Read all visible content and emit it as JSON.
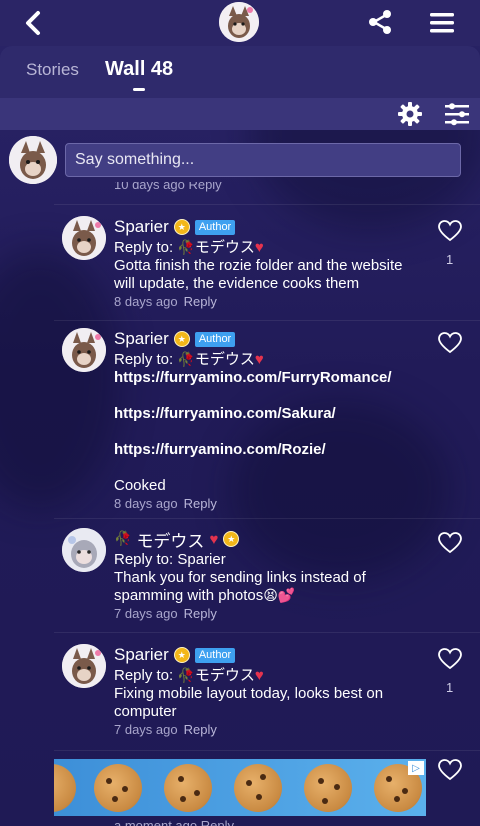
{
  "header": {
    "back_icon": "chevron-left-icon",
    "share_icon": "share-icon",
    "menu_icon": "hamburger-menu-icon"
  },
  "tabs": [
    {
      "label": "Stories",
      "active": false
    },
    {
      "label": "Wall 48",
      "active": true
    }
  ],
  "toolbar": {
    "settings_icon": "gear-icon",
    "filter_icon": "sliders-icon"
  },
  "compose": {
    "placeholder": "Say something..."
  },
  "partial_previous_meta": "10 days ago  Reply",
  "comments": [
    {
      "name": "Sparier",
      "author_tag": "Author",
      "reply_prefix": "Reply to: ",
      "reply_target": "モデウス",
      "body": [
        "Gotta finish the rozie folder and the website",
        "will update, the evidence cooks them"
      ],
      "time": "8 days ago",
      "reply_label": "Reply",
      "likes": "1"
    },
    {
      "name": "Sparier",
      "author_tag": "Author",
      "reply_prefix": "Reply to: ",
      "reply_target": "モデウス",
      "links": [
        "https://furryamino.com/FurryRomance/",
        "https://furryamino.com/Sakura/",
        "https://furryamino.com/Rozie/"
      ],
      "closing": "Cooked",
      "time": "8 days ago",
      "reply_label": "Reply"
    },
    {
      "name": "モデウス",
      "reply_prefix": "Reply to: ",
      "reply_target": "Sparier",
      "body": [
        "Thank you for sending links instead of",
        "spamming with photos"
      ],
      "time": "7 days ago",
      "reply_label": "Reply"
    },
    {
      "name": "Sparier",
      "author_tag": "Author",
      "reply_prefix": "Reply to: ",
      "reply_target": "モデウス",
      "body": [
        "Fixing mobile layout today, looks best on",
        "computer"
      ],
      "time": "7 days ago",
      "reply_label": "Reply",
      "likes": "1"
    }
  ],
  "partial_next_meta": "a moment ago  Reply",
  "ad": {
    "choice_label": "▷"
  },
  "colors": {
    "background": "#241e5e",
    "author_tag": "#3ea0f0",
    "badge_gold": "#f3b71a",
    "meta_text": "#a9a6cc"
  }
}
